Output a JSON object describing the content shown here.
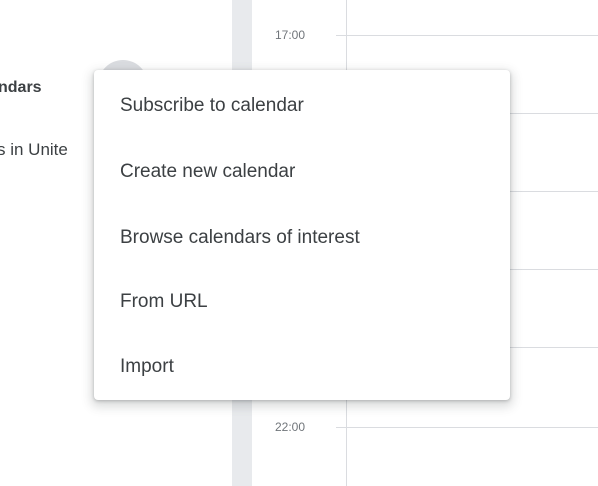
{
  "sidebar": {
    "other_calendars_title": "ndars",
    "holidays_item": "s in Unite"
  },
  "grid": {
    "time_top": "17:00",
    "time_bottom": "22:00"
  },
  "menu": {
    "items": [
      {
        "label": "Subscribe to calendar"
      },
      {
        "label": "Create new calendar"
      },
      {
        "label": "Browse calendars of interest"
      },
      {
        "label": "From URL"
      },
      {
        "label": "Import"
      }
    ]
  }
}
